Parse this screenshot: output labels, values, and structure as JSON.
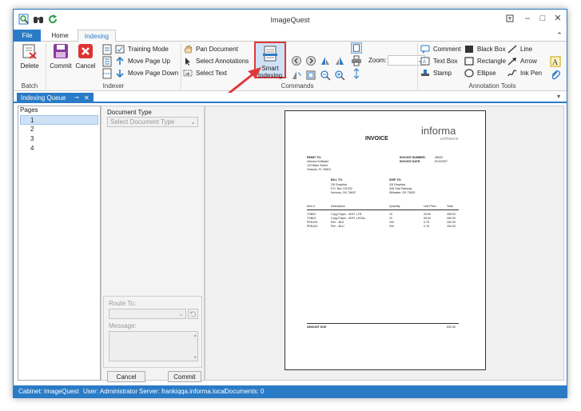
{
  "window": {
    "title": "ImageQuest"
  },
  "menu": {
    "file": "File",
    "tabs": [
      "Home",
      "Indexing"
    ],
    "active_tab": "Indexing"
  },
  "ribbon": {
    "batch": {
      "label": "Batch",
      "delete": "Delete"
    },
    "indexer": {
      "label": "Indexer",
      "commit": "Commit",
      "cancel": "Cancel",
      "training_mode": "Training Mode",
      "move_up": "Move Page Up",
      "move_down": "Move Page Down"
    },
    "commands": {
      "label": "Commands",
      "pan": "Pan Document",
      "select_ann": "Select Annotations",
      "select_text": "Select Text",
      "smart1": "Smart",
      "smart2": "Indexing",
      "zoom": "Zoom:"
    },
    "annotation": {
      "label": "Annotation Tools",
      "comment": "Comment",
      "text_box": "Text Box",
      "stamp": "Stamp",
      "black_box": "Black Box",
      "rectangle": "Rectangle",
      "ellipse": "Ellipse",
      "line": "Line",
      "arrow": "Arrow",
      "ink_pen": "Ink Pen"
    }
  },
  "dock": {
    "tab": "Indexing Queue"
  },
  "pages": {
    "header": "Pages",
    "items": [
      "1",
      "2",
      "3",
      "4"
    ],
    "selected": "1"
  },
  "form": {
    "doc_type_label": "Document Type",
    "doc_type_placeholder": "Select Document Type",
    "route_label": "Route To:",
    "message_label": "Message:",
    "cancel": "Cancel",
    "commit": "Commit"
  },
  "invoice": {
    "title": "INVOICE",
    "logo": "informa",
    "logo_sub": "software",
    "remit_label": "REMIT TO:",
    "remit": [
      "Informa Software",
      "123 Balm Street",
      "Orlando, FL 33810"
    ],
    "invno_label": "INVOICE NUMBER:",
    "invno": "26543",
    "invdate_label": "INVOICE DATE:",
    "invdate": "5/12/2007",
    "bill_label": "BILL TO:",
    "bill": [
      "G8 Graphics",
      "P.O. Box 101332",
      "Norman, OK 75632"
    ],
    "ship_label": "SHIP TO:",
    "ship": [
      "G8 Graphics",
      "345 Oak Parkway",
      "Stillwater, OK 75622"
    ],
    "headers": [
      "Item #",
      "Description",
      "Quantity",
      "Unit Price",
      "Total"
    ],
    "rows": [
      [
        "7GB02",
        "Copy Paper - WHT, LTR",
        "10",
        "25.50",
        "255.00"
      ],
      [
        "7GB03",
        "Copy Paper - WHT, LEGAL",
        "10",
        "28.00",
        "280.00"
      ],
      [
        "PEN100",
        "Pen - BLK",
        "200",
        "0.75",
        "150.00"
      ],
      [
        "PEN102",
        "Pen - BLU",
        "200",
        "0.75",
        "150.00"
      ]
    ],
    "amount_label": "AMOUNT DUE",
    "amount": "832.50"
  },
  "status": {
    "cabinet": "Cabinet: ImageQuest",
    "user": "User: Administrator",
    "server": "Server: frankiqqa.informa.local",
    "documents": "Documents: 0"
  },
  "colors": {
    "accent": "#2a7bc6",
    "highlight": "#e0393b"
  }
}
